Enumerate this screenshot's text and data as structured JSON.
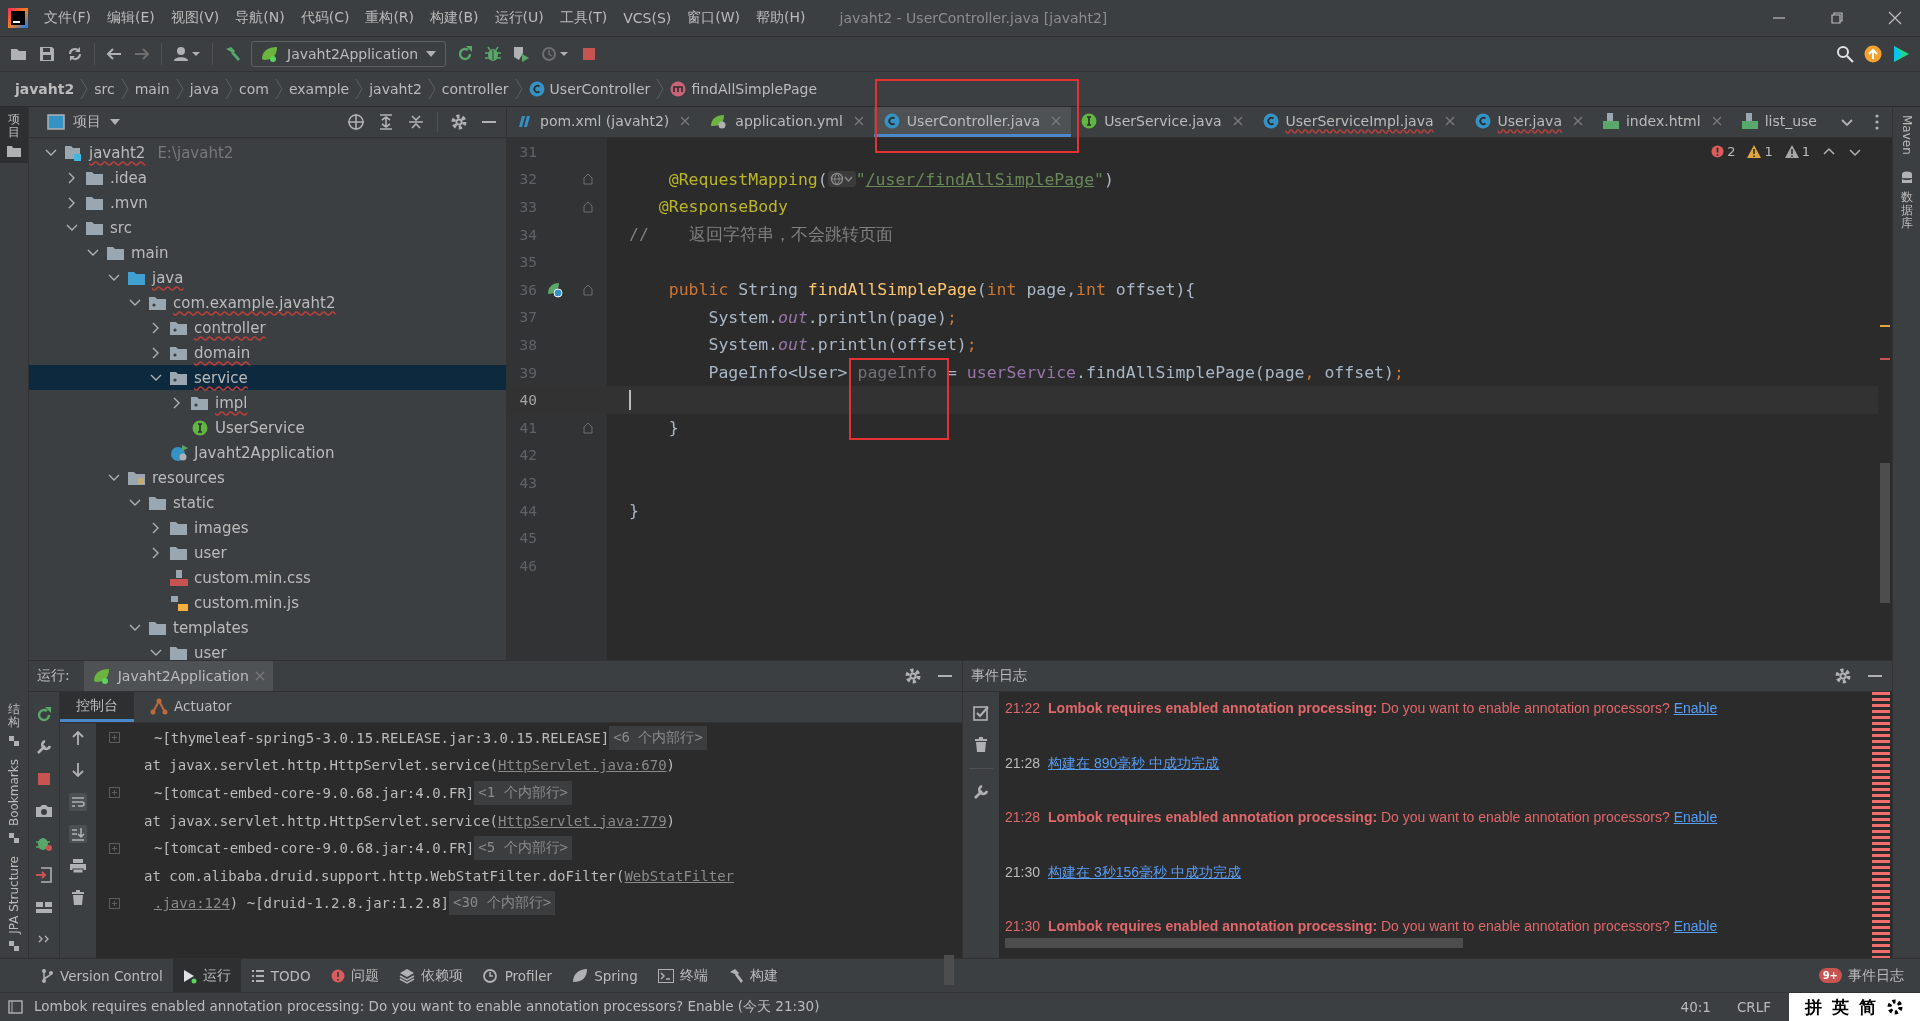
{
  "window": {
    "title": "javaht2 - UserController.java [javaht2]"
  },
  "menu": [
    "文件(F)",
    "编辑(E)",
    "视图(V)",
    "导航(N)",
    "代码(C)",
    "重构(R)",
    "构建(B)",
    "运行(U)",
    "工具(T)",
    "VCS(S)",
    "窗口(W)",
    "帮助(H)"
  ],
  "toolbar": {
    "run_config": "Javaht2Application"
  },
  "breadcrumbs": [
    {
      "label": "javaht2",
      "kind": "project"
    },
    {
      "label": "src",
      "kind": "dir"
    },
    {
      "label": "main",
      "kind": "dir"
    },
    {
      "label": "java",
      "kind": "dir"
    },
    {
      "label": "com",
      "kind": "dir"
    },
    {
      "label": "example",
      "kind": "dir"
    },
    {
      "label": "javaht2",
      "kind": "dir"
    },
    {
      "label": "controller",
      "kind": "dir"
    },
    {
      "label": "UserController",
      "kind": "class"
    },
    {
      "label": "findAllSimplePage",
      "kind": "method"
    }
  ],
  "left_strip": {
    "top": [
      {
        "label": "项目",
        "selected": true
      }
    ],
    "bottom": [
      {
        "label": "结构",
        "selected": false
      },
      {
        "label": "Bookmarks",
        "selected": false
      },
      {
        "label": "JPA Structure",
        "selected": false
      }
    ]
  },
  "right_strip": [
    "Maven",
    "数据库"
  ],
  "project": {
    "title": "项目",
    "tree": [
      {
        "label": "javaht2",
        "kind": "module",
        "hint": "E:\\javaht2",
        "expanded": true,
        "selected": false,
        "children": [
          {
            "label": ".idea",
            "kind": "folder",
            "expanded": false,
            "selected": false
          },
          {
            "label": ".mvn",
            "kind": "folder",
            "expanded": false,
            "selected": false
          },
          {
            "label": "src",
            "kind": "folder",
            "expanded": true,
            "selected": false,
            "children": [
              {
                "label": "main",
                "kind": "folder",
                "expanded": true,
                "selected": false,
                "children": [
                  {
                    "label": "java",
                    "kind": "source",
                    "expanded": true,
                    "selected": false,
                    "children": [
                      {
                        "label": "com.example.javaht2",
                        "kind": "package",
                        "expanded": true,
                        "selected": false,
                        "children": [
                          {
                            "label": "controller",
                            "kind": "package",
                            "expanded": false,
                            "selected": false
                          },
                          {
                            "label": "domain",
                            "kind": "package",
                            "expanded": false,
                            "selected": false
                          },
                          {
                            "label": "service",
                            "kind": "package",
                            "expanded": true,
                            "selected": true,
                            "children": [
                              {
                                "label": "impl",
                                "kind": "package",
                                "expanded": false,
                                "selected": false
                              },
                              {
                                "label": "UserService",
                                "kind": "interface",
                                "selected": false
                              }
                            ]
                          },
                          {
                            "label": "Javaht2Application",
                            "kind": "app",
                            "selected": false
                          }
                        ]
                      }
                    ]
                  },
                  {
                    "label": "resources",
                    "kind": "resources",
                    "expanded": true,
                    "selected": false,
                    "children": [
                      {
                        "label": "static",
                        "kind": "folder",
                        "expanded": true,
                        "selected": false,
                        "children": [
                          {
                            "label": "images",
                            "kind": "folder",
                            "expanded": false,
                            "selected": false
                          },
                          {
                            "label": "user",
                            "kind": "folder",
                            "expanded": false,
                            "selected": false
                          },
                          {
                            "label": "custom.min.css",
                            "kind": "css",
                            "selected": false
                          },
                          {
                            "label": "custom.min.js",
                            "kind": "js",
                            "selected": false
                          }
                        ]
                      },
                      {
                        "label": "templates",
                        "kind": "folder",
                        "expanded": true,
                        "selected": false,
                        "children": [
                          {
                            "label": "user",
                            "kind": "folder",
                            "expanded": true,
                            "selected": false
                          }
                        ]
                      }
                    ]
                  }
                ]
              }
            ]
          }
        ]
      }
    ]
  },
  "editor": {
    "tabs": [
      {
        "label": "pom.xml (javaht2)",
        "kind": "maven",
        "selected": false
      },
      {
        "label": "application.yml",
        "kind": "yaml",
        "selected": false
      },
      {
        "label": "UserController.java",
        "kind": "class",
        "selected": true
      },
      {
        "label": "UserService.java",
        "kind": "interface",
        "selected": false
      },
      {
        "label": "UserServiceImpl.java",
        "kind": "class",
        "selected": false
      },
      {
        "label": "User.java",
        "kind": "class",
        "selected": false
      },
      {
        "label": "index.html",
        "kind": "html",
        "selected": false
      },
      {
        "label": "list_use",
        "kind": "html",
        "selected": false
      }
    ],
    "inspections": [
      {
        "kind": "error",
        "count": "2"
      },
      {
        "kind": "warning",
        "count": "1"
      },
      {
        "kind": "weak",
        "count": "1"
      }
    ],
    "lines": [
      {
        "number": "31"
      },
      {
        "number": "32",
        "fold": true,
        "tokens": [
          {
            "t": "    @RequestMapping",
            "kind": "ann"
          },
          {
            "t": "("
          },
          {
            "kind": "globe"
          },
          {
            "t": "\"",
            "kind": "str"
          },
          {
            "t": "/user/findAllSimplePage",
            "kind": "url"
          },
          {
            "t": "\"",
            "kind": "str"
          },
          {
            "t": ")"
          }
        ]
      },
      {
        "number": "33",
        "fold": true,
        "tokens": [
          {
            "t": "   @ResponseBody",
            "kind": "ann"
          }
        ]
      },
      {
        "number": "34",
        "tokens": [
          {
            "t": "//    返回字符串，不会跳转页面",
            "kind": "comment"
          }
        ]
      },
      {
        "number": "35"
      },
      {
        "number": "36",
        "fold": true,
        "run": true,
        "tokens": [
          {
            "t": "    public",
            "kind": "kw"
          },
          {
            "t": " String "
          },
          {
            "t": "findAllSimplePage",
            "kind": "fn"
          },
          {
            "t": "("
          },
          {
            "t": "int",
            "kind": "kw"
          },
          {
            "t": " page,"
          },
          {
            "t": "int",
            "kind": "kw"
          },
          {
            "t": " offset){"
          }
        ]
      },
      {
        "number": "37",
        "tokens": [
          {
            "t": "        System."
          },
          {
            "t": "out",
            "kind": "static"
          },
          {
            "t": ".println(page)"
          },
          {
            "t": ";",
            "kind": "kw"
          }
        ]
      },
      {
        "number": "38",
        "tokens": [
          {
            "t": "        System."
          },
          {
            "t": "out",
            "kind": "static"
          },
          {
            "t": ".println(offset)"
          },
          {
            "t": ";",
            "kind": "kw"
          }
        ]
      },
      {
        "number": "39",
        "tokens": [
          {
            "t": "        PageInfo<User> "
          },
          {
            "t": "pageInfo",
            "kind": "unused"
          },
          {
            "t": " = "
          },
          {
            "t": "userService",
            "kind": "field"
          },
          {
            "t": ".findAllSimplePage(page"
          },
          {
            "t": ",",
            "kind": "kw"
          },
          {
            "t": " offset)"
          },
          {
            "t": ";",
            "kind": "kw"
          }
        ]
      },
      {
        "number": "40",
        "current": true
      },
      {
        "number": "41",
        "fold": true,
        "tokens": [
          {
            "t": "    }"
          }
        ]
      },
      {
        "number": "42"
      },
      {
        "number": "43"
      },
      {
        "number": "44",
        "tokens": [
          {
            "t": "}"
          }
        ]
      },
      {
        "number": "45"
      },
      {
        "number": "46"
      }
    ]
  },
  "run_panel": {
    "label": "运行:",
    "tab": "Javaht2Application",
    "subtabs": [
      {
        "label": "控制台",
        "kind": "console",
        "selected": true
      },
      {
        "label": "Actuator",
        "kind": "actuator",
        "selected": false
      }
    ],
    "lines": [
      {
        "fold": true,
        "tokens": [
          {
            "t": "~[thymeleaf-spring5-3.0.15.RELEASE.jar:3.0.15.RELEASE]"
          }
        ],
        "badge": "<6 个内部行>"
      },
      {
        "tokens": [
          {
            "t": "at javax.servlet.http.HttpServlet.service("
          },
          {
            "t": "HttpServlet.java:670",
            "kind": "link"
          },
          {
            "t": ")"
          }
        ]
      },
      {
        "fold": true,
        "tokens": [
          {
            "t": "~[tomcat-embed-core-9.0.68.jar:4.0.FR]"
          }
        ],
        "badge": "<1 个内部行>"
      },
      {
        "tokens": [
          {
            "t": "at javax.servlet.http.HttpServlet.service("
          },
          {
            "t": "HttpServlet.java:779",
            "kind": "link"
          },
          {
            "t": ")"
          }
        ]
      },
      {
        "fold": true,
        "tokens": [
          {
            "t": "~[tomcat-embed-core-9.0.68.jar:4.0.FR]"
          }
        ],
        "badge": "<5 个内部行>"
      },
      {
        "tokens": [
          {
            "t": "at com.alibaba.druid.support.http.WebStatFilter.doFilter("
          },
          {
            "t": "WebStatFilter",
            "kind": "link"
          }
        ]
      },
      {
        "fold": true,
        "tokens": [
          {
            "t": ".java:124",
            "kind": "link"
          },
          {
            "t": ") ~[druid-1.2.8.jar:1.2.8]"
          }
        ],
        "badge": "<30 个内部行>"
      }
    ]
  },
  "event_log": {
    "title": "事件日志",
    "entries": [
      {
        "time": "21:22",
        "kind": "warning",
        "message": "**Lombok requires enabled annotation processing:** Do you want to enable annotation processors?",
        "link": "Enable"
      },
      {
        "time": "21:28",
        "kind": "info",
        "link": "构建在 890毫秒 中成功完成"
      },
      {
        "time": "21:28",
        "kind": "warning",
        "message": "**Lombok requires enabled annotation processing:** Do you want to enable annotation processors?",
        "link": "Enable"
      },
      {
        "time": "21:30",
        "kind": "info",
        "link": "构建在 3秒156毫秒 中成功完成"
      },
      {
        "time": "21:30",
        "kind": "warning",
        "message": "**Lombok requires enabled annotation processing:** Do you want to enable annotation processors?",
        "link": "Enable"
      }
    ]
  },
  "tool_windows": [
    {
      "label": "Version Control",
      "kind": "vcs",
      "selected": false
    },
    {
      "label": "运行",
      "kind": "run",
      "selected": true
    },
    {
      "label": "TODO",
      "kind": "todo",
      "selected": false
    },
    {
      "label": "问题",
      "kind": "problems",
      "selected": false
    },
    {
      "label": "依赖项",
      "kind": "deps",
      "selected": false
    },
    {
      "label": "Profiler",
      "kind": "profiler",
      "selected": false
    },
    {
      "label": "Spring",
      "kind": "spring",
      "selected": false
    },
    {
      "label": "终端",
      "kind": "terminal",
      "selected": false
    },
    {
      "label": "构建",
      "kind": "build",
      "selected": false
    }
  ],
  "event_log_button": {
    "badge": "9+",
    "label": "事件日志"
  },
  "status_bar": {
    "message": "Lombok requires enabled annotation processing: Do you want to enable annotation processors? Enable (今天 21:30)",
    "position": "40:1",
    "line_ending": "CRLF",
    "ime": [
      "拼",
      "英",
      "简"
    ]
  }
}
